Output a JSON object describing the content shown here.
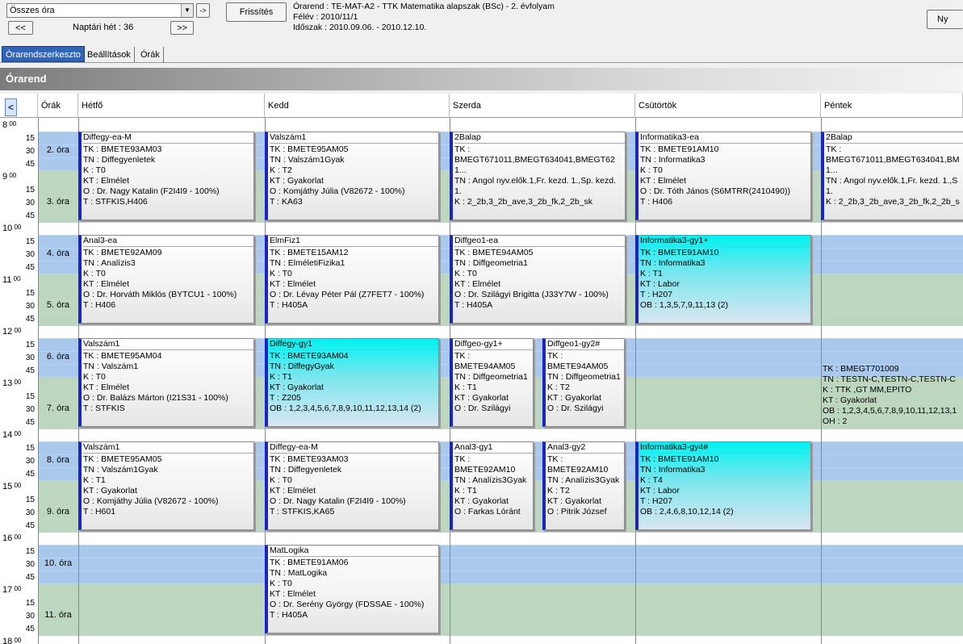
{
  "toolbar": {
    "combo_value": "Összes óra",
    "arrow_label": "->",
    "refresh_label": "Frissítés",
    "prev_label": "<<",
    "next_label": ">>",
    "week_label": "Naptári hét : 36",
    "right_button": "Ny"
  },
  "info": {
    "line1": "Órarend : TE-MAT-A2 - TTK Matematika alapszak (BSc) - 2. évfolyam",
    "line2": "Félév : 2010/11/1",
    "line3": "Időszak : 2010.09.06. - 2010.12.10."
  },
  "tabs": [
    "Órarendszerkeszto",
    "Beállítások",
    "Órák"
  ],
  "banner_title": "Órarend",
  "grid_header": {
    "nav": "<",
    "orak": "Órák",
    "days": [
      "Hétfő",
      "Kedd",
      "Szerda",
      "Csütörtök",
      "Péntek"
    ]
  },
  "hours": [
    "8",
    "9",
    "10",
    "11",
    "12",
    "13",
    "14",
    "15",
    "16",
    "17",
    "18"
  ],
  "hour_sup": "00",
  "minutes": [
    "15",
    "30",
    "45"
  ],
  "periods": [
    "2. óra",
    "3. óra",
    "4. óra",
    "5. óra",
    "6. óra",
    "7. óra",
    "8. óra",
    "9. óra",
    "10. óra",
    "11. óra"
  ],
  "cards": [
    {
      "lines": [
        "Diffegy-ea-M",
        "TK : BMETE93AM03",
        "TN : Diffegyenletek",
        "K : T0",
        "KT : Elmélet",
        "O : Dr. Nagy Katalin (F2I4I9 - 100%)",
        "T : STFKIS,H406"
      ]
    },
    {
      "lines": [
        "Valszám1",
        "TK : BMETE95AM05",
        "TN : Valszám1Gyak",
        "K : T2",
        "KT : Gyakorlat",
        "O : Komjáthy Júlia (V82672 - 100%)",
        "T : KA63"
      ]
    },
    {
      "lines": [
        "2Balap",
        "TK :",
        "BMEGT671011,BMEGT634041,BMEGT62",
        "1...",
        "TN : Angol nyv.elők.1,Fr. kezd. 1.,Sp. kezd.",
        "1.",
        "K : 2_2b,3_2b_ave,3_2b_fk,2_2b_sk"
      ]
    },
    {
      "lines": [
        "Informatika3-ea",
        "TK : BMETE91AM10",
        "TN : Informatika3",
        "K : T0",
        "KT : Elmélet",
        "O : Dr. Tóth János (S6MTRR(2410490))",
        "T : H406"
      ]
    },
    {
      "lines": [
        "2Balap",
        "TK :",
        "BMEGT671011,BMEGT634041,BM",
        "1...",
        "TN : Angol nyv.elők.1,Fr. kezd. 1.,S",
        "1.",
        "K : 2_2b,3_2b_ave,3_2b_fk,2_2b_s"
      ]
    },
    {
      "lines": [
        "Anal3-ea",
        "TK : BMETE92AM09",
        "TN : Analízis3",
        "K : T0",
        "KT : Elmélet",
        "O : Dr. Horváth Miklós (BYTCU1 - 100%)",
        "T : H406"
      ]
    },
    {
      "lines": [
        "ElmFiz1",
        "TK : BMETE15AM12",
        "TN : ElméletiFizika1",
        "K : T0",
        "KT : Elmélet",
        "O : Dr. Lévay Péter Pál (Z7FET7 - 100%)",
        "T : H405A"
      ]
    },
    {
      "lines": [
        "Diffgeo1-ea",
        "TK : BMETE94AM05",
        "TN : Diffgeometria1",
        "K : T0",
        "KT : Elmélet",
        "O : Dr. Szilágyi Brigitta (J33Y7W - 100%)",
        "T : H405A"
      ]
    },
    {
      "lines": [
        "Informatika3-gy1+",
        "TK : BMETE91AM10",
        "TN : Informatika3",
        "K : T1",
        "KT : Labor",
        "T : H207",
        "OB : 1,3,5,7,9,11,13 (2)"
      ]
    },
    {
      "lines": [
        "Valszám1",
        "TK : BMETE95AM04",
        "TN : Valszám1",
        "K : T0",
        "KT : Elmélet",
        "O : Dr. Balázs Márton (I21S31 - 100%)",
        "T : STFKIS"
      ]
    },
    {
      "lines": [
        "Diffegy-gy1",
        "TK : BMETE93AM04",
        "TN : DiffegyGyak",
        "K : T1",
        "KT : Gyakorlat",
        "T : Z205",
        "OB : 1,2,3,4,5,6,7,8,9,10,11,12,13,14 (2)"
      ]
    },
    {
      "lines": [
        "Diffgeo-gy1+",
        "TK :",
        "BMETE94AM05",
        "TN : Diffgeometria1",
        "K : T1",
        "KT : Gyakorlat",
        "O : Dr. Szilágyi"
      ]
    },
    {
      "lines": [
        "Diffgeo1-gy2#",
        "TK :",
        "BMETE94AM05",
        "TN : Diffgeometria1",
        "K : T2",
        "KT : Gyakorlat",
        "O : Dr. Szilágyi"
      ]
    },
    {
      "lines": [
        "TK : BMEGT701009",
        "TN : TESTN-C,TESTN-C,TESTN-C",
        "K : TTK ,GT MM,EPITO",
        "KT : Gyakorlat",
        "OB : 1,2,3,4,5,6,7,8,9,10,11,12,13,1",
        "OH : 2"
      ]
    },
    {
      "lines": [
        "Valszám1",
        "TK : BMETE95AM05",
        "TN : Valszám1Gyak",
        "K : T1",
        "KT : Gyakorlat",
        "O : Komjáthy Júlia (V82672 - 100%)",
        "T : H601"
      ]
    },
    {
      "lines": [
        "Diffegy-ea-M",
        "TK : BMETE93AM03",
        "TN : Diffegyenletek",
        "K : T0",
        "KT : Elmélet",
        "O : Dr. Nagy Katalin (F2I4I9 - 100%)",
        "T : STFKIS,KA65"
      ]
    },
    {
      "lines": [
        "Anal3-gy1",
        "TK :",
        "BMETE92AM10",
        "TN : Analízis3Gyak",
        "K : T1",
        "KT : Gyakorlat",
        "O : Farkas Lóránt"
      ]
    },
    {
      "lines": [
        "Anal3-gy2",
        "TK :",
        "BMETE92AM10",
        "TN : Analízis3Gyak",
        "K : T2",
        "KT : Gyakorlat",
        "O : Pitrik József"
      ]
    },
    {
      "lines": [
        "Informatika3-gy4#",
        "TK : BMETE91AM10",
        "TN : Informatika3",
        "K : T4",
        "KT : Labor",
        "T : H207",
        "OB : 2,4,6,8,10,12,14 (2)"
      ]
    },
    {
      "lines": [
        "MatLogika",
        "TK : BMETE91AM06",
        "TN : MatLogika",
        "K : T0",
        "KT : Elmélet",
        "O : Dr. Serény György (FDSSAE - 100%)",
        "T : H405A"
      ]
    }
  ]
}
